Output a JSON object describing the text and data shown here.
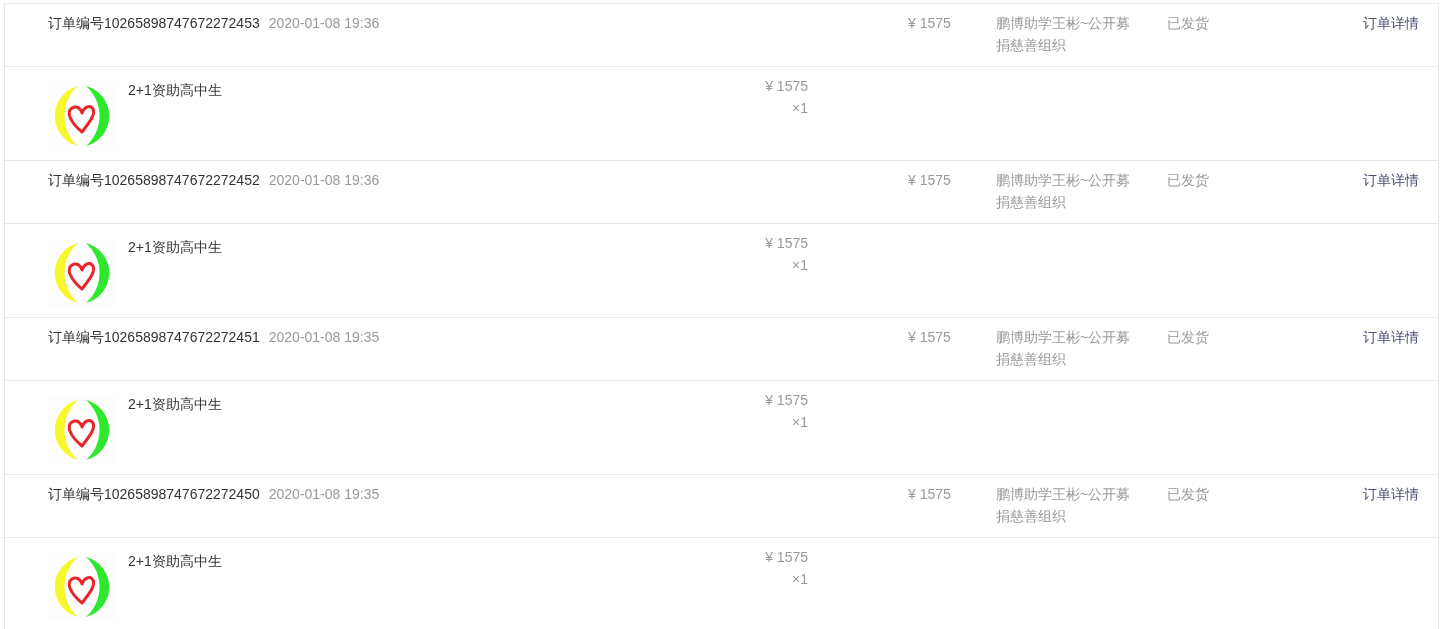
{
  "orders": [
    {
      "order_number": "订单编号10265898747672272453",
      "time": "2020-01-08 19:36",
      "total": "¥ 1575",
      "organization": "鹏博助学王彬~公开募捐慈善组织",
      "status": "已发货",
      "detail_link": "订单详情",
      "items": [
        {
          "name": "2+1资助高中生",
          "price": "¥ 1575",
          "quantity": "×1"
        }
      ]
    },
    {
      "order_number": "订单编号10265898747672272452",
      "time": "2020-01-08 19:36",
      "total": "¥ 1575",
      "organization": "鹏博助学王彬~公开募捐慈善组织",
      "status": "已发货",
      "detail_link": "订单详情",
      "items": [
        {
          "name": "2+1资助高中生",
          "price": "¥ 1575",
          "quantity": "×1"
        }
      ]
    },
    {
      "order_number": "订单编号10265898747672272451",
      "time": "2020-01-08 19:35",
      "total": "¥ 1575",
      "organization": "鹏博助学王彬~公开募捐慈善组织",
      "status": "已发货",
      "detail_link": "订单详情",
      "items": [
        {
          "name": "2+1资助高中生",
          "price": "¥ 1575",
          "quantity": "×1"
        }
      ]
    },
    {
      "order_number": "订单编号10265898747672272450",
      "time": "2020-01-08 19:35",
      "total": "¥ 1575",
      "organization": "鹏博助学王彬~公开募捐慈善组织",
      "status": "已发货",
      "detail_link": "订单详情",
      "items": [
        {
          "name": "2+1资助高中生",
          "price": "¥ 1575",
          "quantity": "×1"
        }
      ]
    }
  ]
}
